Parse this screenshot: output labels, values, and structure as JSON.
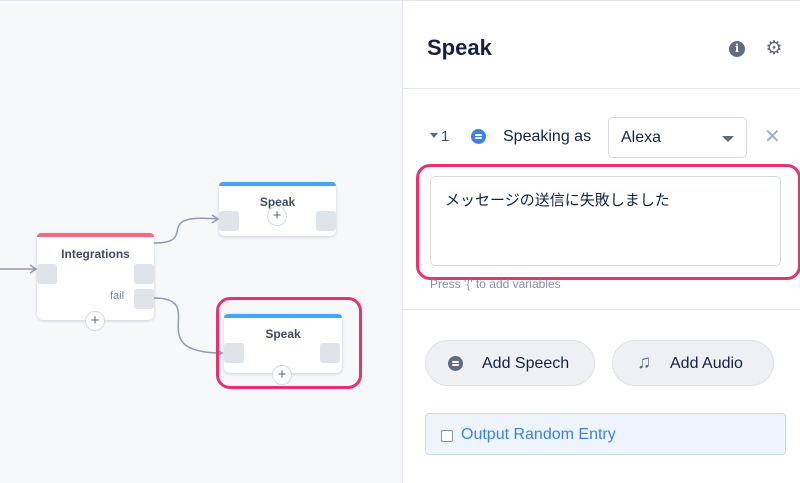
{
  "canvas": {
    "blocks": [
      {
        "id": "speak_top",
        "title": "Speak",
        "bar_color": "#42a5f5"
      },
      {
        "id": "integrations",
        "title": "Integrations",
        "bar_color": "#ef6b7d",
        "fail_label": "fail"
      },
      {
        "id": "speak_bottom",
        "title": "Speak",
        "bar_color": "#42a5f5"
      }
    ],
    "add_symbol": "+"
  },
  "panel": {
    "title": "Speak",
    "info_icon": "info-icon",
    "settings_icon": "gear-icon",
    "speech_item": {
      "index": "1",
      "speaking_label": "Speaking as",
      "voice": "Alexa",
      "text": "メッセージの送信に失敗しました",
      "hint": "Press '{' to add variables"
    },
    "buttons": {
      "add_speech": "Add Speech",
      "add_audio": "Add Audio"
    },
    "output_random_label": "Output Random Entry"
  },
  "colors": {
    "highlight": "#e8326d",
    "accent": "#3d82e2",
    "speak_bar": "#42a5f5",
    "integrations_bar": "#ef6b7d"
  }
}
